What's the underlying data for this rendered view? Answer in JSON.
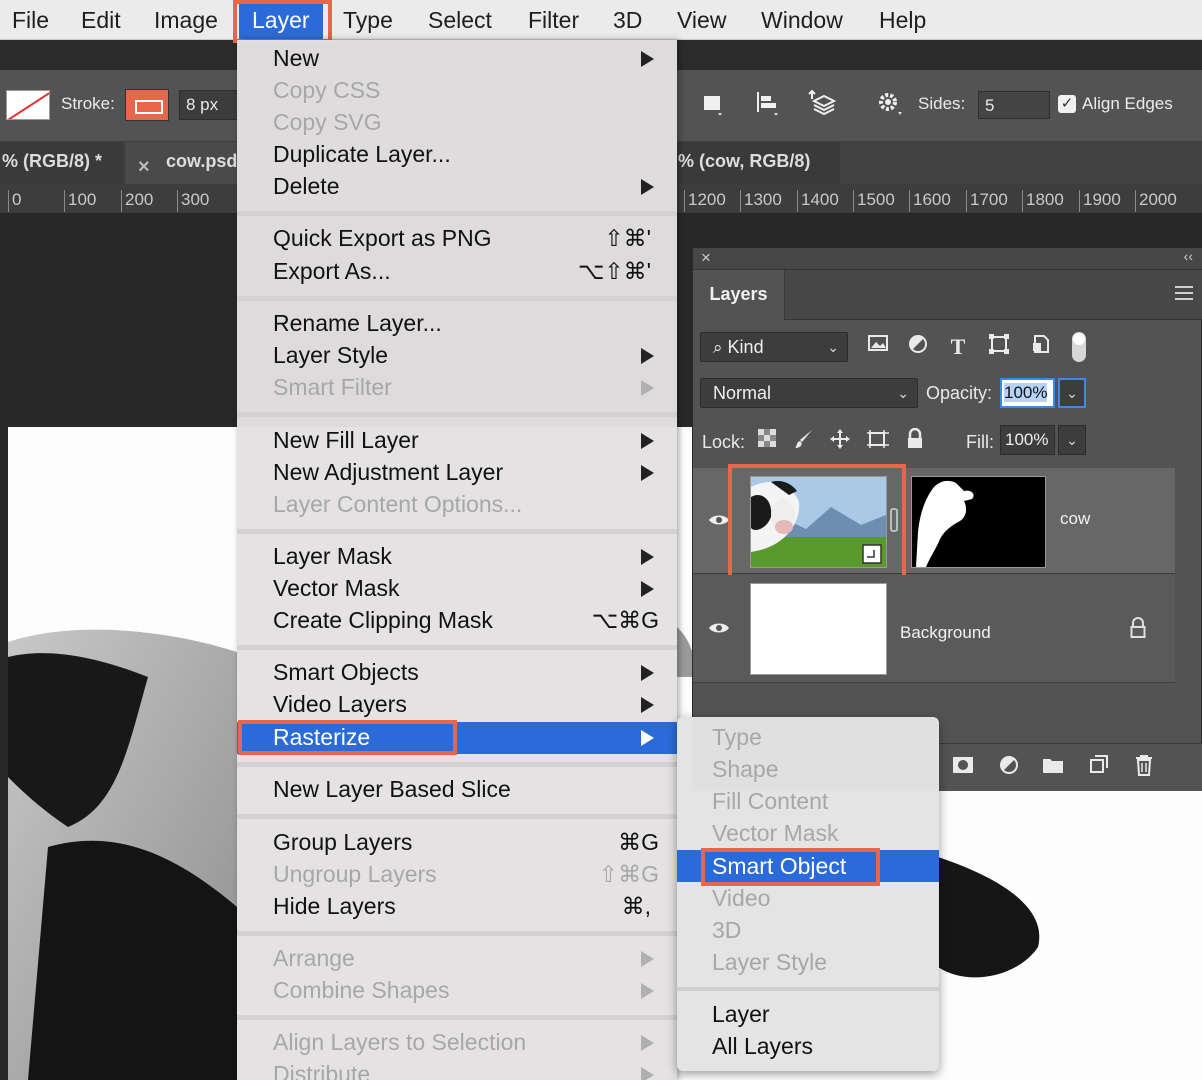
{
  "menubar": {
    "items": [
      "File",
      "Edit",
      "Image",
      "Layer",
      "Type",
      "Select",
      "Filter",
      "3D",
      "View",
      "Window",
      "Help"
    ]
  },
  "options": {
    "stroke_label": "Stroke:",
    "stroke_width": "8 px",
    "sides_label": "Sides:",
    "sides_value": "5",
    "align_edges_label": "Align Edges",
    "align_edges_checked": true
  },
  "doc_tabs": {
    "tab1": "% (RGB/8) *",
    "tab2": "cow.psd",
    "tab3": "% (cow, RGB/8)"
  },
  "ruler": {
    "labels_left": [
      "0",
      "100",
      "200",
      "300"
    ],
    "labels_right": [
      "1200",
      "1300",
      "1400",
      "1500",
      "1600",
      "1700",
      "1800",
      "1900",
      "2000"
    ]
  },
  "layer_menu": {
    "new": "New",
    "copy_css": "Copy CSS",
    "copy_svg": "Copy SVG",
    "duplicate": "Duplicate Layer...",
    "delete": "Delete",
    "quick_export": "Quick Export as PNG",
    "quick_export_sc": "⇧⌘'",
    "export_as": "Export As...",
    "export_as_sc": "⌥⇧⌘'",
    "rename": "Rename Layer...",
    "layer_style": "Layer Style",
    "smart_filter": "Smart Filter",
    "new_fill": "New Fill Layer",
    "new_adjustment": "New Adjustment Layer",
    "content_options": "Layer Content Options...",
    "layer_mask": "Layer Mask",
    "vector_mask": "Vector Mask",
    "clipping_mask": "Create Clipping Mask",
    "clipping_mask_sc": "⌥⌘G",
    "smart_objects": "Smart Objects",
    "video_layers": "Video Layers",
    "rasterize": "Rasterize",
    "slice": "New Layer Based Slice",
    "group": "Group Layers",
    "group_sc": "⌘G",
    "ungroup": "Ungroup Layers",
    "ungroup_sc": "⇧⌘G",
    "hide": "Hide Layers",
    "hide_sc": "⌘,",
    "arrange": "Arrange",
    "combine": "Combine Shapes",
    "align": "Align Layers to Selection",
    "distribute": "Distribute"
  },
  "rasterize_menu": {
    "type": "Type",
    "shape": "Shape",
    "fill_content": "Fill Content",
    "vector_mask": "Vector Mask",
    "smart_object": "Smart Object",
    "video": "Video",
    "three_d": "3D",
    "layer_style": "Layer Style",
    "layer": "Layer",
    "all_layers": "All Layers"
  },
  "layers_panel": {
    "tab": "Layers",
    "kind_label": "Kind",
    "blend_mode": "Normal",
    "opacity_label": "Opacity:",
    "opacity_value": "100%",
    "lock_label": "Lock:",
    "fill_label": "Fill:",
    "fill_value": "100%",
    "layers": [
      {
        "name": "cow",
        "smart_object": true,
        "has_mask": true,
        "visible": true
      },
      {
        "name": "Background",
        "locked": true,
        "visible": true
      }
    ]
  },
  "colors": {
    "highlight_blue": "#2a6bd9",
    "annotation_orange": "#e8664a",
    "panel_gray": "#535353"
  }
}
